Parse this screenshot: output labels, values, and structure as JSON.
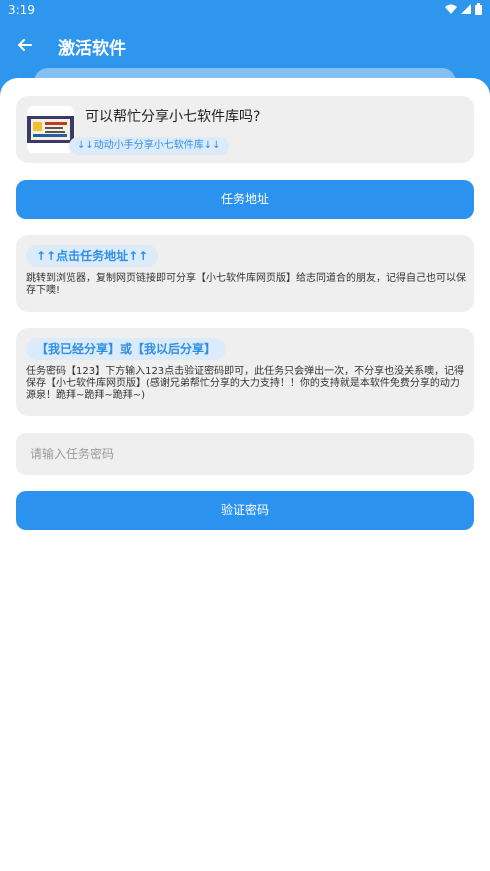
{
  "status": {
    "time": "3:19"
  },
  "appbar": {
    "title": "激活软件"
  },
  "share_card": {
    "title": "可以帮忙分享小七软件库吗?",
    "chip": "↓↓动动小手分享小七软件库↓↓"
  },
  "task_button": {
    "label": "任务地址"
  },
  "tip_card": {
    "chip": "↑↑点击任务地址↑↑",
    "text": "跳转到浏览器，复制网页链接即可分享【小七软件库网页版】给志同道合的朋友，记得自己也可以保存下噢!"
  },
  "notice_card": {
    "chip": "【我已经分享】或【我以后分享】",
    "text": "任务密码【123】下方输入123点击验证密码即可，此任务只会弹出一次，不分享也没关系噢，记得保存【小七软件库网页版】(感谢兄弟帮忙分享的大力支持！！你的支持就是本软件免费分享的动力源泉！跪拜~跪拜~跪拜~)"
  },
  "password_input": {
    "value": "",
    "placeholder": "请输入任务密码"
  },
  "verify_button": {
    "label": "验证密码"
  },
  "colors": {
    "primary": "#2b93ef",
    "chip_bg": "#dcebf9",
    "card_bg": "#efefef"
  },
  "icons": [
    "back-arrow-icon",
    "wifi-icon",
    "signal-icon",
    "battery-icon"
  ]
}
